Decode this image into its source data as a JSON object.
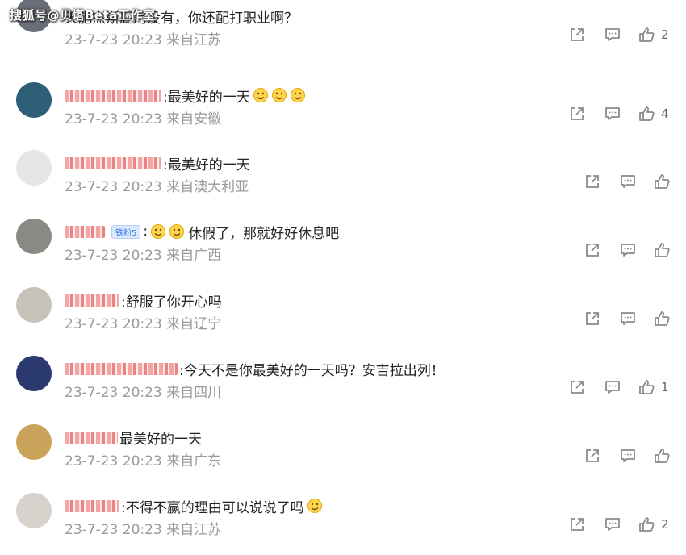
{
  "watermark": "搜狐号@贝塔Beta工作室",
  "comments": [
    {
      "user_width": 0,
      "text": "天肥杰斯屁用没有，你还配打职业啊？",
      "time": "23-7-23 20:23",
      "location": "来自江苏",
      "likes": "2",
      "badge": "",
      "emojis": 0
    },
    {
      "user_width": 120,
      "text": ":最美好的一天",
      "time": "23-7-23 20:23",
      "location": "来自安徽",
      "likes": "4",
      "badge": "",
      "emojis": 3
    },
    {
      "user_width": 120,
      "text": ":最美好的一天",
      "time": "23-7-23 20:23",
      "location": "来自澳大利亚",
      "likes": "",
      "badge": "",
      "emojis": 0
    },
    {
      "user_width": 50,
      "text": "休假了，那就好好休息吧",
      "time": "23-7-23 20:23",
      "location": "来自广西",
      "likes": "",
      "badge": "铁粉5",
      "emojis": 2
    },
    {
      "user_width": 68,
      "text": ":舒服了你开心吗",
      "time": "23-7-23 20:23",
      "location": "来自辽宁",
      "likes": "",
      "badge": "",
      "emojis": 0
    },
    {
      "user_width": 140,
      "text": ":今天不是你最美好的一天吗？安吉拉出列！",
      "time": "23-7-23 20:23",
      "location": "来自四川",
      "likes": "1",
      "badge": "",
      "emojis": 0
    },
    {
      "user_width": 66,
      "text": "最美好的一天",
      "time": "23-7-23 20:23",
      "location": "来自广东",
      "likes": "",
      "badge": "",
      "emojis": 0
    },
    {
      "user_width": 68,
      "text": ":不得不赢的理由可以说说了吗",
      "time": "23-7-23 20:23",
      "location": "来自江苏",
      "likes": "2",
      "badge": "",
      "emojis": 1
    }
  ],
  "colors": {
    "text": "#222222",
    "meta": "#9a9a9a",
    "icon": "#8a8a8a",
    "username_redacted": "#f29b9b"
  },
  "icons": {
    "share": "share-icon",
    "comment": "comment-icon",
    "like": "like-icon"
  }
}
